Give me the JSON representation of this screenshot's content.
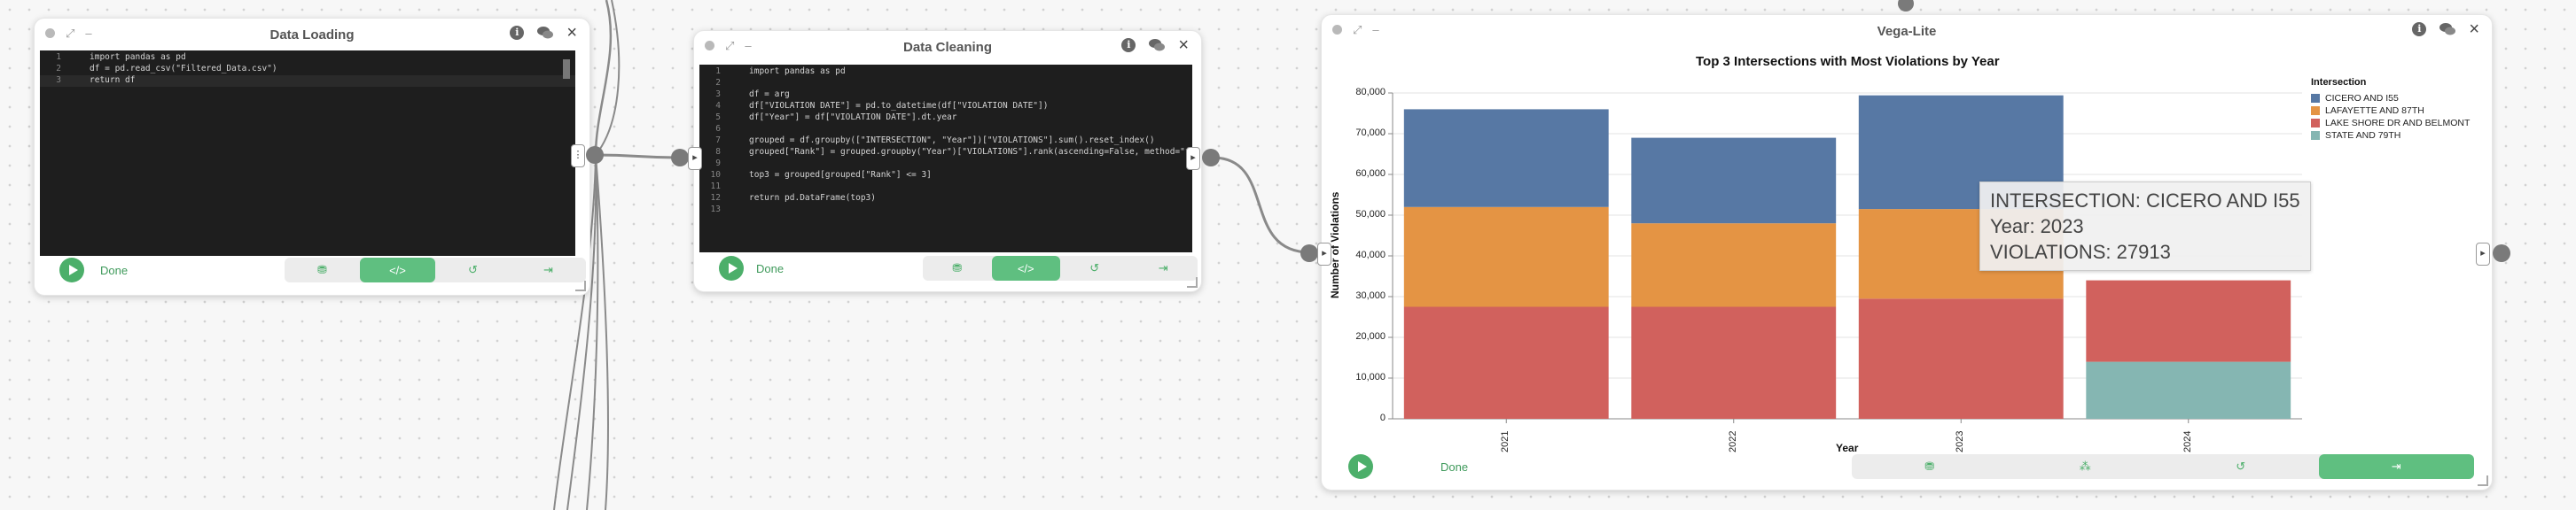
{
  "nodes": {
    "loading": {
      "title": "Data Loading",
      "status": "Done",
      "line_numbers": [
        "1",
        "2",
        "3"
      ],
      "code_lines": [
        "import pandas as pd",
        "df = pd.read_csv(\"Filtered_Data.csv\")",
        "return df"
      ]
    },
    "cleaning": {
      "title": "Data Cleaning",
      "status": "Done",
      "line_numbers": [
        "1",
        "2",
        "3",
        "4",
        "5",
        "6",
        "7",
        "8",
        "9",
        "10",
        "11",
        "12",
        "13"
      ],
      "code_lines": [
        "import pandas as pd",
        "",
        "df = arg",
        "df[\"VIOLATION DATE\"] = pd.to_datetime(df[\"VIOLATION DATE\"])",
        "df[\"Year\"] = df[\"VIOLATION DATE\"].dt.year",
        "",
        "grouped = df.groupby([\"INTERSECTION\", \"Year\"])[\"VIOLATIONS\"].sum().reset_index()",
        "grouped[\"Rank\"] = grouped.groupby(\"Year\")[\"VIOLATIONS\"].rank(ascending=False, method=\"first\")",
        "",
        "top3 = grouped[grouped[\"Rank\"] <= 3]",
        "",
        "return pd.DataFrame(top3)",
        ""
      ]
    },
    "vega": {
      "title": "Vega-Lite",
      "status": "Done"
    }
  },
  "icons": {
    "info": "i",
    "close": "×"
  },
  "colors": {
    "accent_green": "#4caf6a",
    "editor_bg": "#1e1e1e"
  },
  "tooltip": {
    "intersection": "INTERSECTION: CICERO AND I55",
    "year": "Year: 2023",
    "violations": "VIOLATIONS: 27913"
  },
  "chart_data": {
    "type": "bar",
    "stacked": true,
    "title": "Top 3 Intersections with Most Violations by Year",
    "xlabel": "Year",
    "ylabel": "Number of Violations",
    "categories": [
      "2021",
      "2022",
      "2023",
      "2024"
    ],
    "ylim": [
      0,
      80000
    ],
    "yticks": [
      "0",
      "10,000",
      "20,000",
      "30,000",
      "40,000",
      "50,000",
      "60,000",
      "70,000",
      "80,000"
    ],
    "legend_title": "Intersection",
    "legend_position": "right",
    "series": [
      {
        "name": "CICERO AND I55",
        "color": "#5778a4",
        "values": [
          24000,
          21000,
          27913,
          0
        ]
      },
      {
        "name": "LAFAYETTE AND 87TH",
        "color": "#e49444",
        "values": [
          24500,
          20500,
          22000,
          0
        ]
      },
      {
        "name": "LAKE SHORE DR AND BELMONT",
        "color": "#d1615d",
        "values": [
          27500,
          27500,
          29500,
          20000
        ]
      },
      {
        "name": "STATE AND 79TH",
        "color": "#85b6b2",
        "values": [
          0,
          0,
          0,
          14000
        ]
      }
    ]
  }
}
